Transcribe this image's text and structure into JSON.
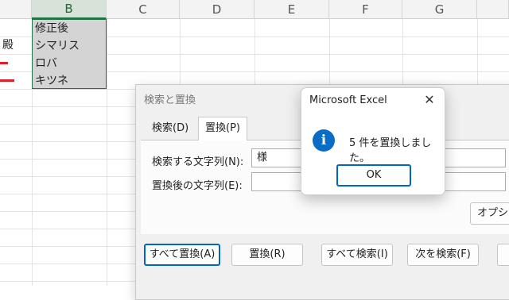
{
  "sheet": {
    "columns": [
      "B",
      "C",
      "D",
      "E",
      "F",
      "G"
    ],
    "rows": [
      {
        "a": "",
        "b": "修正後"
      },
      {
        "a": "殿",
        "b": "シマリス"
      },
      {
        "a": "",
        "b": "ロバ"
      },
      {
        "a": "",
        "b": "キツネ"
      }
    ]
  },
  "find_replace": {
    "title": "検索と置換",
    "tabs": [
      "検索(D)",
      "置換(P)"
    ],
    "find_label": "検索する文字列(N):",
    "find_value": "様",
    "replace_label": "置換後の文字列(E):",
    "replace_value": "",
    "options_label": "オプショ",
    "buttons": {
      "replace_all": "すべて置換(A)",
      "replace": "置換(R)",
      "find_all": "すべて検索(I)",
      "find_next": "次を検索(F)"
    }
  },
  "message_box": {
    "title": "Microsoft Excel",
    "close_glyph": "✕",
    "icon_glyph": "i",
    "message": "5 件を置換しました。",
    "ok_label": "OK"
  },
  "colors": {
    "selection_border": "#217346",
    "info_icon": "#0a6cc4",
    "default_button_border": "#0067c0",
    "red_mark": "#e21f26"
  }
}
